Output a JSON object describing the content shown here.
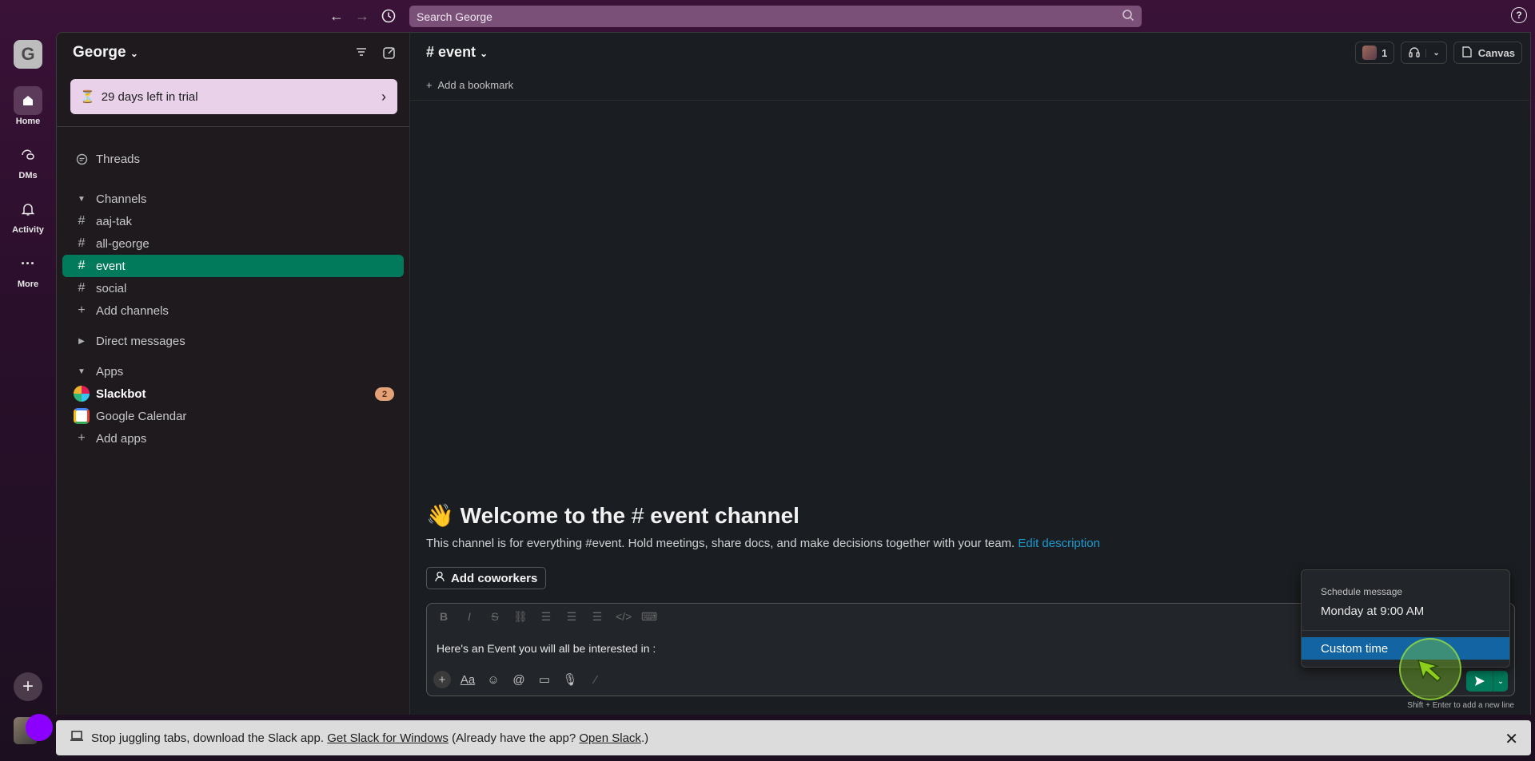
{
  "search": {
    "placeholder": "Search George"
  },
  "rail": {
    "workspace_initial": "G",
    "items": [
      {
        "label": "Home"
      },
      {
        "label": "DMs"
      },
      {
        "label": "Activity"
      },
      {
        "label": "More"
      }
    ]
  },
  "sidebar": {
    "workspace": "George",
    "trial": "29 days left in trial",
    "threads": "Threads",
    "channels_header": "Channels",
    "channels": [
      "aaj-tak",
      "all-george",
      "event",
      "social"
    ],
    "add_channels": "Add channels",
    "dms_header": "Direct messages",
    "apps_header": "Apps",
    "apps": [
      {
        "label": "Slackbot",
        "badge": "2"
      },
      {
        "label": "Google Calendar"
      }
    ],
    "add_apps": "Add apps"
  },
  "header": {
    "channel": "event",
    "members_count": "1",
    "canvas": "Canvas",
    "bookmark": "Add a bookmark"
  },
  "welcome": {
    "emoji": "👋",
    "title": "Welcome to the",
    "channel": "event channel",
    "description": "This channel is for everything #event. Hold meetings, share docs, and make decisions together with your team.",
    "edit_link": "Edit description",
    "add_coworkers": "Add coworkers"
  },
  "composer": {
    "message": "Here's an Event you will all be interested in :",
    "hint": "Shift + Enter to add a new line"
  },
  "schedule_menu": {
    "header": "Schedule message",
    "option_1": "Monday at 9:00 AM",
    "option_2": "Custom time"
  },
  "banner": {
    "text_1": "Stop juggling tabs, download the Slack app.",
    "link_1": "Get Slack for Windows",
    "text_2": "(Already have the app?",
    "link_2": "Open Slack",
    "text_3": ".)"
  },
  "colors": {
    "active_channel": "#007a5a",
    "trial_bg": "#e9d1ea",
    "link": "#1d9bd1",
    "menu_highlight": "#1264a3"
  }
}
